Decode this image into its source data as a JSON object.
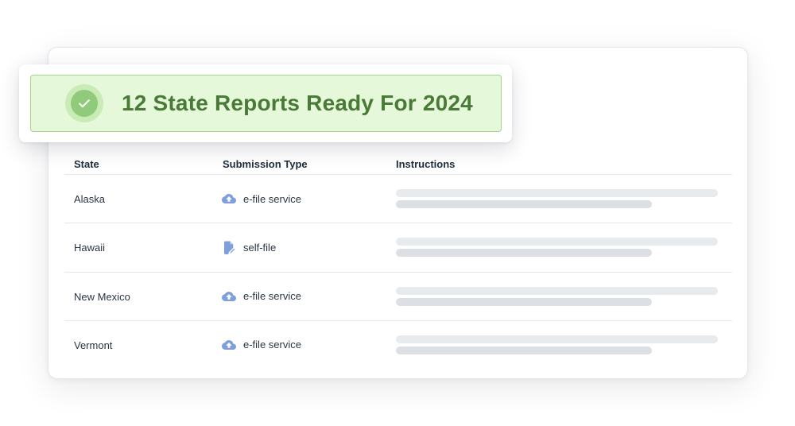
{
  "banner": {
    "title": "12 State Reports Ready For 2024",
    "icon": "check-circle-icon",
    "colors": {
      "background": "#e5f8d9",
      "border": "#a6d68e",
      "text": "#4a7a38",
      "check": "#8fcb7a"
    }
  },
  "table": {
    "headers": {
      "state": "State",
      "submission_type": "Submission Type",
      "instructions": "Instructions"
    },
    "rows": [
      {
        "state": "Alaska",
        "submission_type": "e-file service",
        "icon": "cloud-upload-icon"
      },
      {
        "state": "Hawaii",
        "submission_type": "self-file",
        "icon": "document-edit-icon"
      },
      {
        "state": "New Mexico",
        "submission_type": "e-file service",
        "icon": "cloud-upload-icon"
      },
      {
        "state": "Vermont",
        "submission_type": "e-file service",
        "icon": "cloud-upload-icon"
      }
    ]
  },
  "colors": {
    "icon": "#7f9fdc",
    "skeleton_light": "#e8ebee",
    "skeleton_dark": "#dcdfe3"
  }
}
